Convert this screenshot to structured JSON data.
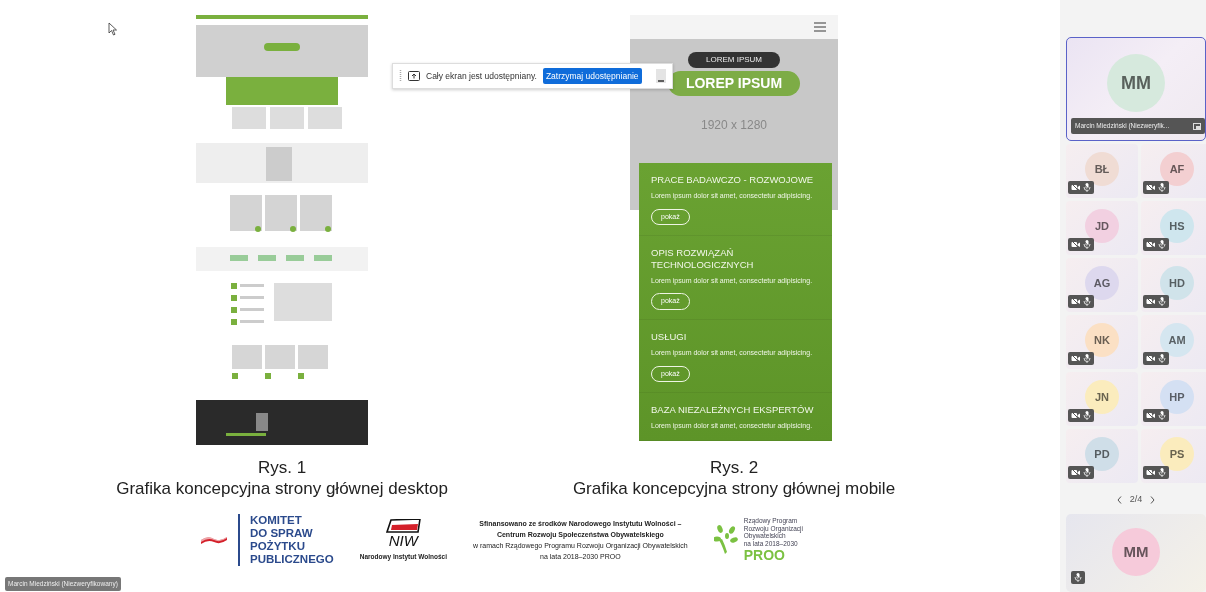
{
  "share_bar": {
    "message": "Cały ekran jest udostępniany.",
    "stop_button": "Zatrzymaj udostępnianie"
  },
  "slide": {
    "figures": [
      {
        "kind": "desktop",
        "number": "Rys. 1",
        "caption": "Grafika koncepcyjna strony głównej desktop"
      },
      {
        "kind": "mobile",
        "number": "Rys. 2",
        "caption": "Grafika koncepcyjna strony głównej mobile"
      }
    ],
    "mobile_mockup": {
      "hero_tag": "LOREM IPSUM",
      "hero_title": "LOREP IPSUM",
      "size_label": "1920 x 1280",
      "sections": [
        {
          "title": "PRACE BADAWCZO - ROZWOJOWE",
          "text": "Lorem ipsum dolor sit amet, consectetur adipisicing.",
          "button": "pokaż"
        },
        {
          "title": "OPIS ROZWIĄZAŃ TECHNOLOGICZNYCH",
          "text": "Lorem ipsum dolor sit amet, consectetur adipisicing.",
          "button": "pokaż"
        },
        {
          "title": "USŁUGI",
          "text": "Lorem ipsum dolor sit amet, consectetur adipisicing.",
          "button": "pokaż"
        },
        {
          "title": "BAZA NIEZALEŻNYCH EKSPERTÓW",
          "text": "Lorem ipsum dolor sit amet, consectetur adipisicing."
        }
      ]
    },
    "logos": {
      "komitet": [
        "KOMITET",
        "DO SPRAW",
        "POŻYTKU",
        "PUBLICZNEGO"
      ],
      "niw": {
        "mark": "NIW",
        "name": "Narodowy Instytut Wolności"
      },
      "funding": [
        "**Sfinansowano ze środków Narodowego Instytutu Wolności –**",
        "**Centrum Rozwoju Społeczeństwa Obywatelskiego**",
        "w ramach Rządowego Programu Rozwoju Organizacji Obywatelskich",
        "na lata 2018–2030 PROO"
      ],
      "proo": {
        "lines": [
          "Rządowy Program",
          "Rozwoju Organizacji",
          "Obywatelskich",
          "na lata 2018–2030"
        ],
        "mark": "PROO"
      }
    }
  },
  "participants": {
    "featured": {
      "initials": "MM",
      "name": "Marcin Miedziński (Niezweryfik...",
      "color": "#d6e9dd",
      "highlighted": true
    },
    "grid": [
      {
        "initials": "BŁ",
        "color": "#f0dcd4"
      },
      {
        "initials": "AF",
        "color": "#f3cfd1"
      },
      {
        "initials": "JD",
        "color": "#f2d0e1"
      },
      {
        "initials": "HS",
        "color": "#cfe6ee"
      },
      {
        "initials": "AG",
        "color": "#ddd8ee"
      },
      {
        "initials": "HD",
        "color": "#d0e3ea"
      },
      {
        "initials": "NK",
        "color": "#fbe0c4"
      },
      {
        "initials": "AM",
        "color": "#d5e6f0"
      },
      {
        "initials": "JN",
        "color": "#fbecbd"
      },
      {
        "initials": "HP",
        "color": "#d4e0f3"
      },
      {
        "initials": "PD",
        "color": "#cfdee8"
      },
      {
        "initials": "PS",
        "color": "#fbecbd"
      }
    ],
    "pager": "2/4",
    "self": {
      "initials": "MM",
      "color": "#f6cada",
      "muted": true
    }
  },
  "presenter_label": "Marcin Miedziński (Niezweryfikowany)"
}
